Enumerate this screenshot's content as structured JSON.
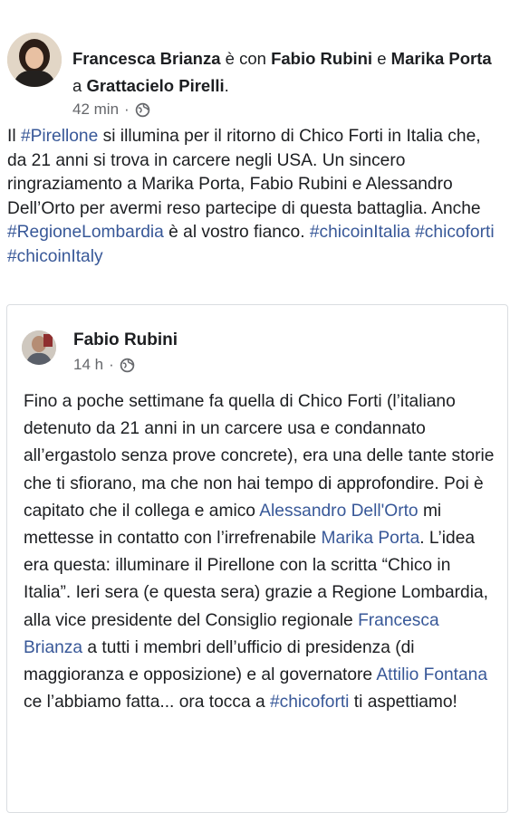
{
  "post": {
    "author": "Francesca Brianza",
    "with_text": " è con ",
    "tagged1": "Fabio Rubini",
    "and_text": " e ",
    "tagged2": "Marika Porta",
    "at_text": " a ",
    "location": "Grattacielo Pirelli",
    "period": ".",
    "time": "42 min",
    "dot": "·",
    "text": {
      "p1": "Il ",
      "tag1": "#Pirellone",
      "p2": " si illumina per il ritorno di Chico Forti in Italia che, da 21 anni si trova in carcere negli USA. Un sincero ringraziamento a Marika Porta, Fabio Rubini e Alessandro Dell’Orto per avermi reso partecipe di questa battaglia. Anche ",
      "tag2": "#RegioneLombardia",
      "p3": " è al vostro fianco. ",
      "tag3": "#chicoinItalia",
      "tag4": "#chicoforti",
      "tag5": "#chicoinItaly",
      "space": " "
    }
  },
  "shared": {
    "author": "Fabio Rubini",
    "time": "14 h",
    "dot": "·",
    "text": {
      "s1": "Fino a poche settimane fa quella di Chico Forti (l’italiano detenuto da 21 anni in un carcere usa e condannato all’ergastolo senza prove concrete), era una delle tante storie che ti sfiorano, ma che non hai tempo di approfondire. Poi è capitato che il collega e amico ",
      "l1": "Alessandro Dell'Orto",
      "s2": " mi mettesse in contatto con l’irrefrenabile ",
      "l2": "Marika Porta",
      "s3": ". L’idea era questa: illuminare il Pirellone con la scritta “Chico in Italia”. Ieri sera (e questa sera) grazie a Regione Lombardia, alla vice presidente del Consiglio regionale ",
      "l3": "Francesca Brianza",
      "s4": " a tutti i membri dell’ufficio di presidenza (di maggioranza e opposizione) e al governatore ",
      "l4": "Attilio Fontana",
      "s5": " ce l’abbiamo fatta... ora tocca a ",
      "l5": "#chicoforti",
      "s6": " ti aspettiamo!"
    }
  },
  "icons": {
    "privacy": "globe-icon"
  }
}
